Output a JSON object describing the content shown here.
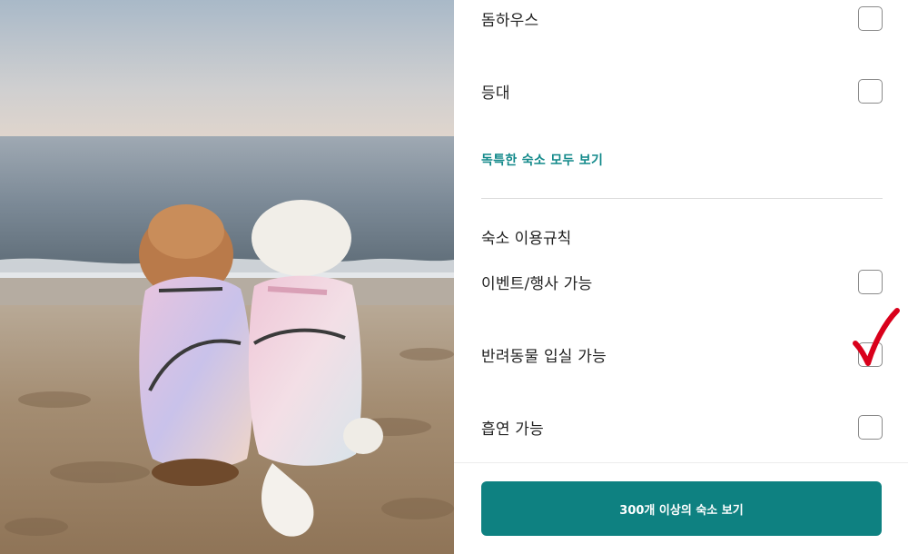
{
  "photo": {
    "icon": "two-dogs-on-beach-photo"
  },
  "filters": {
    "property_types": [
      {
        "label": "돔하우스",
        "checked": false
      },
      {
        "label": "등대",
        "checked": false
      }
    ],
    "show_all_link": "독특한 숙소 모두 보기",
    "rules_section": {
      "title": "숙소 이용규칙",
      "items": [
        {
          "label": "이벤트/행사 가능",
          "checked": false
        },
        {
          "label": "반려동물 입실 가능",
          "checked": true
        },
        {
          "label": "흡연 가능",
          "checked": false
        }
      ]
    }
  },
  "footer": {
    "cta_label": "300개 이상의 숙소 보기"
  },
  "colors": {
    "accent": "#0e8181",
    "link": "#12898a",
    "annotation": "#d9001b"
  }
}
